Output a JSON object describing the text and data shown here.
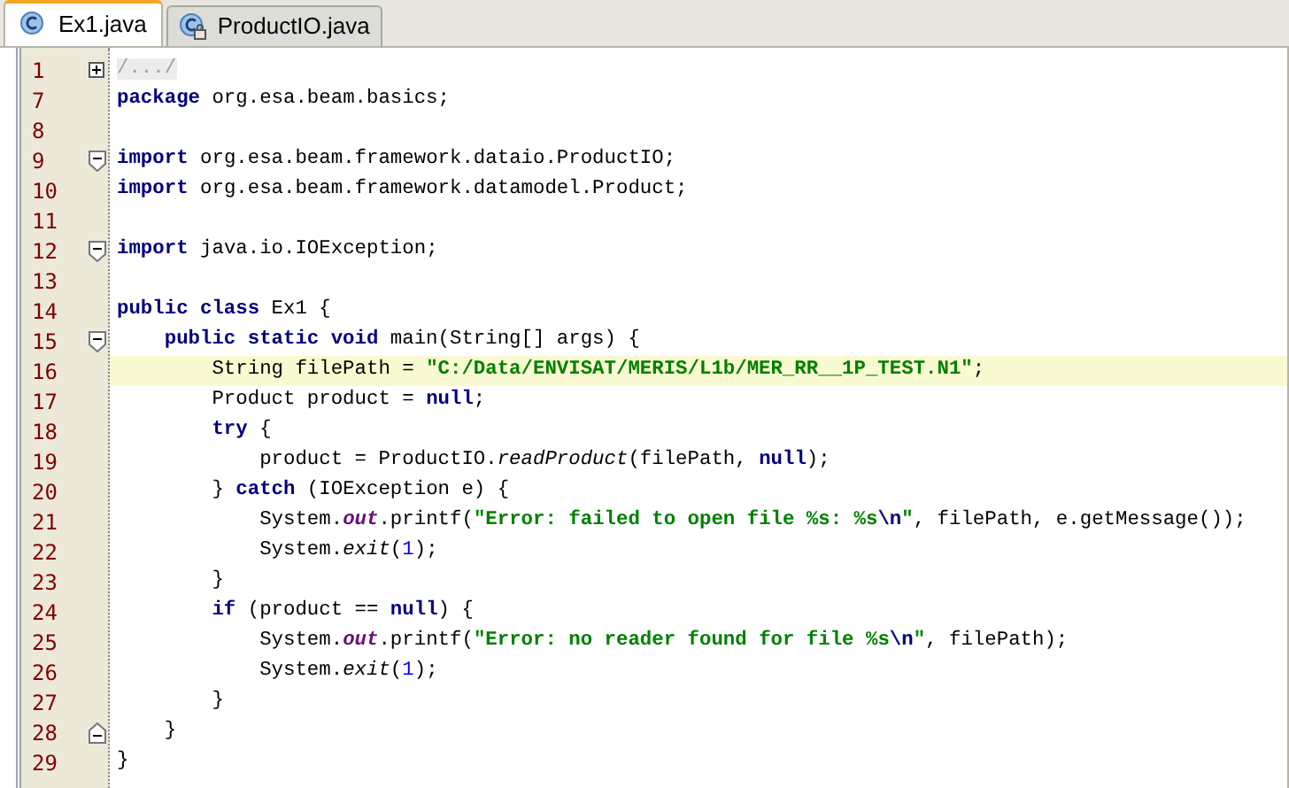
{
  "tabs": [
    {
      "label": "Ex1.java",
      "selected": true,
      "locked": false
    },
    {
      "label": "ProductIO.java",
      "selected": false,
      "locked": true
    }
  ],
  "lines": [
    {
      "number": "1",
      "kind": "expand",
      "highlighted": false,
      "tokens": [
        {
          "kind": "folded",
          "text": "/.../"
        }
      ]
    },
    {
      "number": "7",
      "kind": "plain",
      "highlighted": false,
      "tokens": [
        {
          "kind": "keyword",
          "text": "package"
        },
        {
          "kind": "plain",
          "text": " org.esa.beam.basics;"
        }
      ]
    },
    {
      "number": "8",
      "kind": "plain",
      "highlighted": false
    },
    {
      "number": "9",
      "kind": "collapse",
      "highlighted": false,
      "tokens": [
        {
          "kind": "keyword",
          "text": "import"
        },
        {
          "kind": "plain",
          "text": " org.esa.beam.framework.dataio.ProductIO;"
        }
      ]
    },
    {
      "number": "10",
      "kind": "plain",
      "highlighted": false,
      "tokens": [
        {
          "kind": "keyword",
          "text": "import"
        },
        {
          "kind": "plain",
          "text": " org.esa.beam.framework.datamodel.Product;"
        }
      ]
    },
    {
      "number": "11",
      "kind": "plain",
      "highlighted": false
    },
    {
      "number": "12",
      "kind": "collapse",
      "highlighted": false,
      "tokens": [
        {
          "kind": "keyword",
          "text": "import"
        },
        {
          "kind": "plain",
          "text": " java.io.IOException;"
        }
      ]
    },
    {
      "number": "13",
      "kind": "plain",
      "highlighted": false
    },
    {
      "number": "14",
      "kind": "plain",
      "highlighted": false,
      "tokens": [
        {
          "kind": "keyword",
          "text": "public class"
        },
        {
          "kind": "plain",
          "text": " Ex1 {"
        }
      ]
    },
    {
      "number": "15",
      "kind": "collapse",
      "highlighted": false,
      "tokens": [
        {
          "kind": "keyword",
          "text": "    public static void"
        },
        {
          "kind": "plain",
          "text": " main(String[] args) {"
        }
      ]
    },
    {
      "number": "16",
      "kind": "plain",
      "highlighted": true,
      "tokens": [
        {
          "kind": "plain",
          "text": "        String filePath = "
        },
        {
          "kind": "string",
          "text": "\"C:/Data/ENVISAT/MERIS/L1b/MER_RR__1P_TEST.N1\""
        },
        {
          "kind": "plain",
          "text": ";"
        }
      ]
    },
    {
      "number": "17",
      "kind": "plain",
      "highlighted": false,
      "tokens": [
        {
          "kind": "plain",
          "text": "        Product product = "
        },
        {
          "kind": "keyword",
          "text": "null"
        },
        {
          "kind": "plain",
          "text": ";"
        }
      ]
    },
    {
      "number": "18",
      "kind": "plain",
      "highlighted": false,
      "tokens": [
        {
          "kind": "keyword",
          "text": "        try"
        },
        {
          "kind": "plain",
          "text": " {"
        }
      ]
    },
    {
      "number": "19",
      "kind": "plain",
      "highlighted": false,
      "tokens": [
        {
          "kind": "plain",
          "text": "            product = ProductIO."
        },
        {
          "kind": "method",
          "text": "readProduct"
        },
        {
          "kind": "plain",
          "text": "(filePath, "
        },
        {
          "kind": "keyword",
          "text": "null"
        },
        {
          "kind": "plain",
          "text": ");"
        }
      ]
    },
    {
      "number": "20",
      "kind": "plain",
      "highlighted": false,
      "tokens": [
        {
          "kind": "plain",
          "text": "        } "
        },
        {
          "kind": "keyword",
          "text": "catch"
        },
        {
          "kind": "plain",
          "text": " (IOException e) {"
        }
      ]
    },
    {
      "number": "21",
      "kind": "plain",
      "highlighted": false,
      "tokens": [
        {
          "kind": "plain",
          "text": "            System."
        },
        {
          "kind": "field",
          "text": "out"
        },
        {
          "kind": "plain",
          "text": ".printf("
        },
        {
          "kind": "string",
          "text": "\"Error: failed to open file %s: %s"
        },
        {
          "kind": "escape",
          "text": "\\n"
        },
        {
          "kind": "string",
          "text": "\""
        },
        {
          "kind": "plain",
          "text": ", filePath, e.getMessage());"
        }
      ]
    },
    {
      "number": "22",
      "kind": "plain",
      "highlighted": false,
      "tokens": [
        {
          "kind": "plain",
          "text": "            System."
        },
        {
          "kind": "method",
          "text": "exit"
        },
        {
          "kind": "plain",
          "text": "("
        },
        {
          "kind": "number",
          "text": "1"
        },
        {
          "kind": "plain",
          "text": ");"
        }
      ]
    },
    {
      "number": "23",
      "kind": "plain",
      "highlighted": false,
      "tokens": [
        {
          "kind": "plain",
          "text": "        }"
        }
      ]
    },
    {
      "number": "24",
      "kind": "plain",
      "highlighted": false,
      "tokens": [
        {
          "kind": "keyword",
          "text": "        if"
        },
        {
          "kind": "plain",
          "text": " (product == "
        },
        {
          "kind": "keyword",
          "text": "null"
        },
        {
          "kind": "plain",
          "text": ") {"
        }
      ]
    },
    {
      "number": "25",
      "kind": "plain",
      "highlighted": false,
      "tokens": [
        {
          "kind": "plain",
          "text": "            System."
        },
        {
          "kind": "field",
          "text": "out"
        },
        {
          "kind": "plain",
          "text": ".printf("
        },
        {
          "kind": "string",
          "text": "\"Error: no reader found for file %s"
        },
        {
          "kind": "escape",
          "text": "\\n"
        },
        {
          "kind": "string",
          "text": "\""
        },
        {
          "kind": "plain",
          "text": ", filePath);"
        }
      ]
    },
    {
      "number": "26",
      "kind": "plain",
      "highlighted": false,
      "tokens": [
        {
          "kind": "plain",
          "text": "            System."
        },
        {
          "kind": "method",
          "text": "exit"
        },
        {
          "kind": "plain",
          "text": "("
        },
        {
          "kind": "number",
          "text": "1"
        },
        {
          "kind": "plain",
          "text": ");"
        }
      ]
    },
    {
      "number": "27",
      "kind": "plain",
      "highlighted": false,
      "tokens": [
        {
          "kind": "plain",
          "text": "        }"
        }
      ]
    },
    {
      "number": "28",
      "kind": "fold-end",
      "highlighted": false,
      "tokens": [
        {
          "kind": "plain",
          "text": "    }"
        }
      ]
    },
    {
      "number": "29",
      "kind": "plain",
      "highlighted": false,
      "tokens": [
        {
          "kind": "plain",
          "text": "}"
        }
      ]
    }
  ]
}
